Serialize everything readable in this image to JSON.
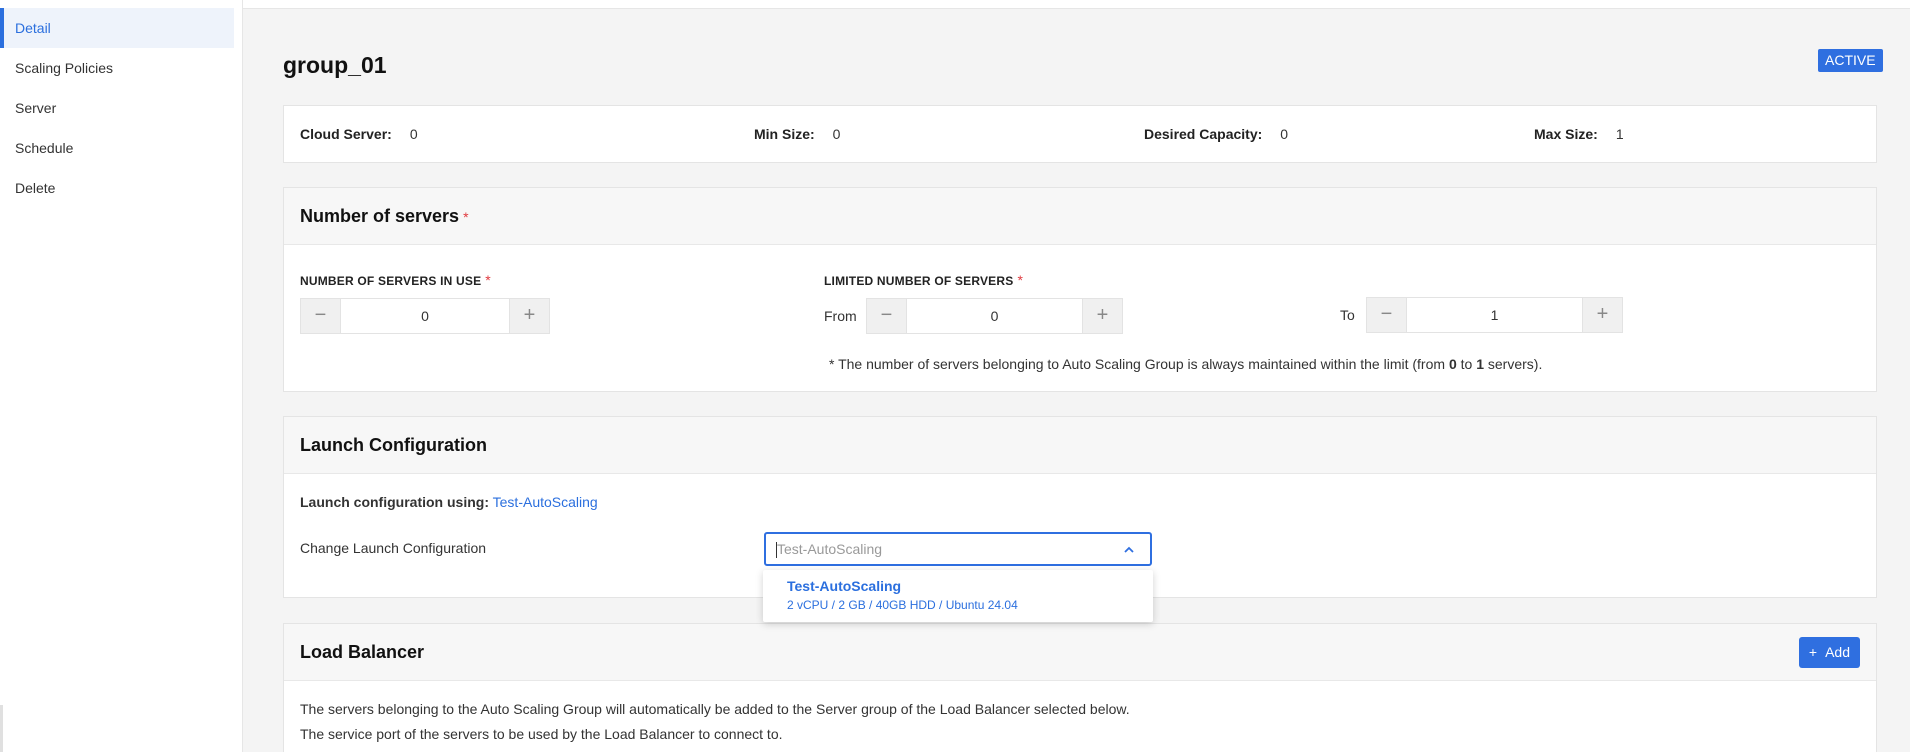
{
  "sidebar": {
    "items": [
      {
        "label": "Detail"
      },
      {
        "label": "Scaling Policies"
      },
      {
        "label": "Server"
      },
      {
        "label": "Schedule"
      },
      {
        "label": "Delete"
      }
    ]
  },
  "header": {
    "title": "group_01",
    "status": "ACTIVE"
  },
  "summary": {
    "cloud_server_label": "Cloud Server:",
    "cloud_server_value": "0",
    "min_size_label": "Min Size:",
    "min_size_value": "0",
    "desired_capacity_label": "Desired Capacity:",
    "desired_capacity_value": "0",
    "max_size_label": "Max Size:",
    "max_size_value": "1"
  },
  "servers_section": {
    "title": "Number of servers",
    "required_mark": "*",
    "in_use_label": "NUMBER OF SERVERS IN USE",
    "in_use_value": "0",
    "limited_label": "LIMITED NUMBER OF SERVERS",
    "from_label": "From",
    "from_value": "0",
    "to_label": "To",
    "to_value": "1",
    "note_prefix": "* The number of servers belonging to Auto Scaling Group is always maintained within the limit (from ",
    "note_from": "0",
    "note_mid": " to ",
    "note_to": "1",
    "note_suffix": " servers).",
    "minus_symbol": "−",
    "plus_symbol": "+"
  },
  "launch_section": {
    "title": "Launch Configuration",
    "using_label": "Launch configuration using:",
    "using_value": "Test-AutoScaling",
    "change_label": "Change Launch Configuration",
    "select_placeholder": "Test-AutoScaling",
    "dropdown_options": [
      {
        "title": "Test-AutoScaling",
        "subtitle": "2 vCPU / 2 GB / 40GB HDD / Ubuntu 24.04"
      }
    ]
  },
  "lb_section": {
    "title": "Load Balancer",
    "add_label": "Add",
    "add_icon": "+",
    "line1": "The servers belonging to the Auto Scaling Group will automatically be added to the Server group of the Load Balancer selected below.",
    "line2": "The service port of the servers to be used by the Load Balancer to connect to."
  },
  "colors": {
    "accent": "#2f6fe0",
    "required": "#e0393e"
  }
}
